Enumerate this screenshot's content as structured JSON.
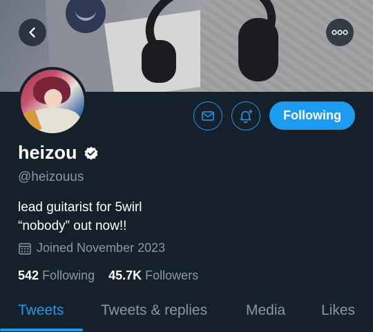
{
  "profile": {
    "name": "heizou",
    "handle": "@heizouus",
    "bio_line1": "lead guitarist for 5wirl",
    "bio_line2": "“nobody” out now!!",
    "joined": "Joined November 2023"
  },
  "actions": {
    "follow_label": "Following"
  },
  "stats": {
    "following_count": "542",
    "following_label": "Following",
    "followers_count": "45.7K",
    "followers_label": "Followers"
  },
  "tabs": [
    {
      "label": "Tweets",
      "active": true
    },
    {
      "label": "Tweets & replies",
      "active": false
    },
    {
      "label": "Media",
      "active": false
    },
    {
      "label": "Likes",
      "active": false
    }
  ],
  "colors": {
    "background": "#15202b",
    "accent": "#1d9bf0",
    "secondary_text": "#8899a6"
  },
  "icons": {
    "back": "back-arrow-icon",
    "more": "more-options-icon",
    "message": "envelope-icon",
    "notify": "bell-plus-icon",
    "verified": "verified-badge-icon",
    "calendar": "calendar-icon"
  }
}
